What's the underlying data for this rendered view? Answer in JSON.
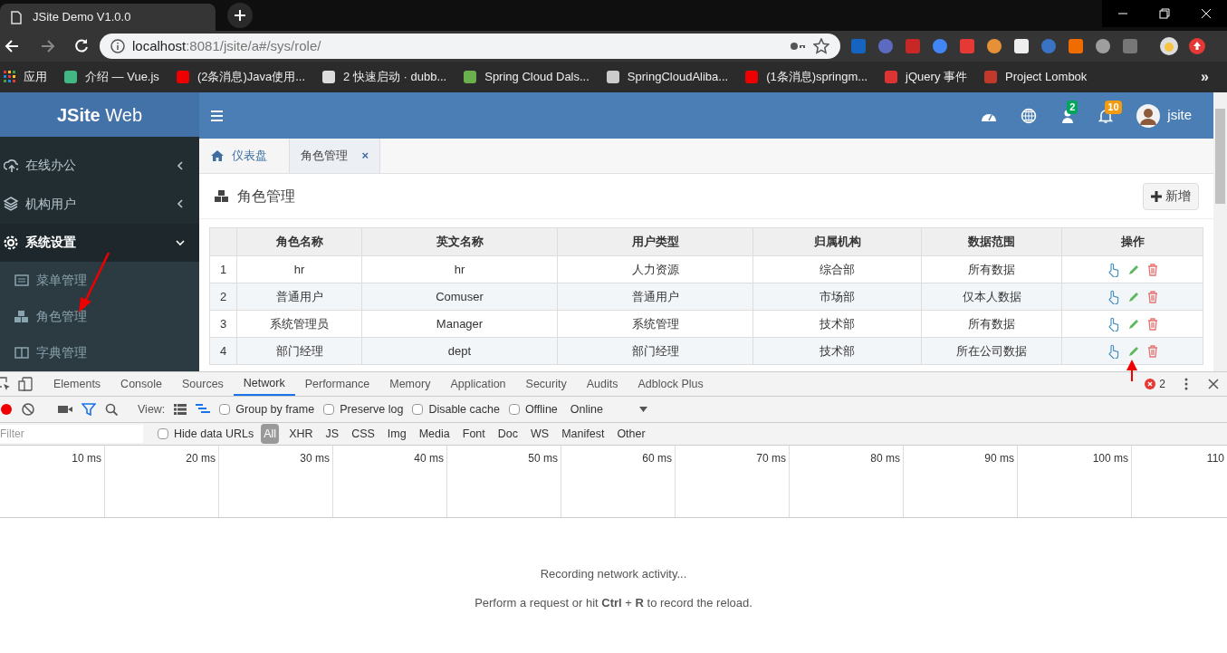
{
  "browser": {
    "tab_title": "JSite Demo V1.0.0",
    "url_host": "localhost",
    "url_rest": ":8081/jsite/a#/sys/role/",
    "apps_label": "应用",
    "bookmarks": [
      {
        "label": "介绍 — Vue.js"
      },
      {
        "label": "(2条消息)Java使用..."
      },
      {
        "label": "2 快速启动 · dubb..."
      },
      {
        "label": "Spring Cloud Dals..."
      },
      {
        "label": "SpringCloudAliba..."
      },
      {
        "label": "(1条消息)springm..."
      },
      {
        "label": "jQuery 事件"
      },
      {
        "label": "Project Lombok"
      }
    ],
    "more": "»"
  },
  "app": {
    "brand_bold": "JSite",
    "brand_light": "Web",
    "user_badge": "2",
    "bell_badge": "10",
    "username": "jsite",
    "sidebar": [
      {
        "label": "在线办公",
        "expanded": false,
        "selected": false
      },
      {
        "label": "机构用户",
        "expanded": false,
        "selected": false
      },
      {
        "label": "系统设置",
        "expanded": true,
        "selected": true,
        "children": [
          {
            "label": "菜单管理"
          },
          {
            "label": "角色管理"
          },
          {
            "label": "字典管理"
          }
        ]
      }
    ],
    "tabs": [
      {
        "label": "仪表盘",
        "selected": false,
        "closable": false
      },
      {
        "label": "角色管理",
        "selected": true,
        "closable": true,
        "close": "×"
      }
    ],
    "page_title": "角色管理",
    "add_button": "新增",
    "table": {
      "columns": [
        "角色名称",
        "英文名称",
        "用户类型",
        "归属机构",
        "数据范围",
        "操作"
      ],
      "rows": [
        {
          "index": "1",
          "cells": [
            "hr",
            "hr",
            "人力资源",
            "综合部",
            "所有数据"
          ]
        },
        {
          "index": "2",
          "cells": [
            "普通用户",
            "Comuser",
            "普通用户",
            "市场部",
            "仅本人数据"
          ]
        },
        {
          "index": "3",
          "cells": [
            "系统管理员",
            "Manager",
            "系统管理",
            "技术部",
            "所有数据"
          ]
        },
        {
          "index": "4",
          "cells": [
            "部门经理",
            "dept",
            "部门经理",
            "技术部",
            "所在公司数据"
          ]
        }
      ]
    }
  },
  "devtools": {
    "tabs": [
      {
        "label": "Elements",
        "selected": false
      },
      {
        "label": "Console",
        "selected": false
      },
      {
        "label": "Sources",
        "selected": false
      },
      {
        "label": "Network",
        "selected": true
      },
      {
        "label": "Performance",
        "selected": false
      },
      {
        "label": "Memory",
        "selected": false
      },
      {
        "label": "Application",
        "selected": false
      },
      {
        "label": "Security",
        "selected": false
      },
      {
        "label": "Audits",
        "selected": false
      },
      {
        "label": "Adblock Plus",
        "selected": false
      }
    ],
    "error_count": "2",
    "view_label": "View:",
    "options": [
      {
        "label": "Group by frame",
        "checked": false
      },
      {
        "label": "Preserve log",
        "checked": false
      },
      {
        "label": "Disable cache",
        "checked": false
      },
      {
        "label": "Offline",
        "checked": false
      }
    ],
    "throttle": "Online",
    "filter_placeholder": "Filter",
    "hide_data_urls": {
      "label": "Hide data URLs",
      "checked": false
    },
    "types": [
      {
        "label": "All",
        "selected": true
      },
      {
        "label": "XHR",
        "selected": false
      },
      {
        "label": "JS",
        "selected": false
      },
      {
        "label": "CSS",
        "selected": false
      },
      {
        "label": "Img",
        "selected": false
      },
      {
        "label": "Media",
        "selected": false
      },
      {
        "label": "Font",
        "selected": false
      },
      {
        "label": "Doc",
        "selected": false
      },
      {
        "label": "WS",
        "selected": false
      },
      {
        "label": "Manifest",
        "selected": false
      },
      {
        "label": "Other",
        "selected": false
      }
    ],
    "ticks": [
      "10 ms",
      "20 ms",
      "30 ms",
      "40 ms",
      "50 ms",
      "60 ms",
      "70 ms",
      "80 ms",
      "90 ms",
      "100 ms",
      "110"
    ],
    "message": "Recording network activity...",
    "hint": "Perform a request or hit **Ctrl** + **R** to record the reload."
  }
}
